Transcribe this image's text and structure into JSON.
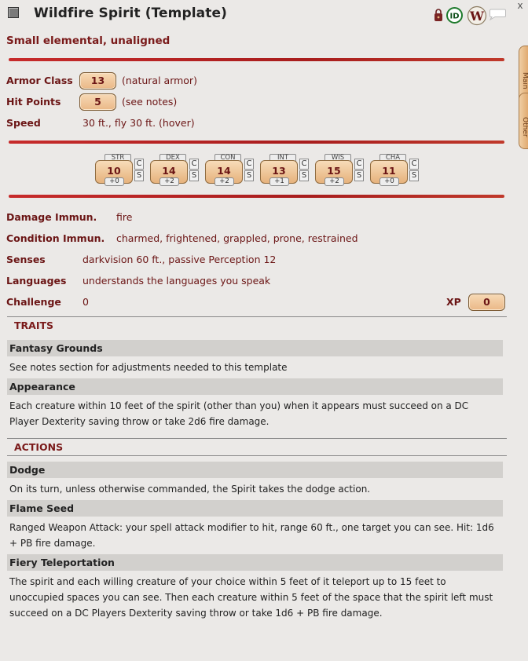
{
  "header": {
    "title": "Wildfire Spirit (Template)",
    "close": "x",
    "subtitle": "Small elemental, unaligned"
  },
  "header_icons": [
    "lock-icon",
    "id-icon",
    "wiki-icon",
    "chat-icon"
  ],
  "id_badge": "ID",
  "wiki_badge": "W",
  "side_tabs": {
    "main": "Main",
    "other": "Other"
  },
  "stats": {
    "armor_class": {
      "label": "Armor Class",
      "value": "13",
      "note": "(natural armor)"
    },
    "hit_points": {
      "label": "Hit Points",
      "value": "5",
      "note": "(see notes)"
    },
    "speed": {
      "label": "Speed",
      "value": "30 ft., fly 30 ft. (hover)"
    }
  },
  "abilities": [
    {
      "label": "STR",
      "score": "10",
      "mod": "+0"
    },
    {
      "label": "DEX",
      "score": "14",
      "mod": "+2"
    },
    {
      "label": "CON",
      "score": "14",
      "mod": "+2"
    },
    {
      "label": "INT",
      "score": "13",
      "mod": "+1"
    },
    {
      "label": "WIS",
      "score": "15",
      "mod": "+2"
    },
    {
      "label": "CHA",
      "score": "11",
      "mod": "+0"
    }
  ],
  "check_label": "C",
  "save_label": "S",
  "details": {
    "damage_immunities": {
      "label": "Damage Immun.",
      "value": "fire"
    },
    "condition_immunities": {
      "label": "Condition Immun.",
      "value": "charmed, frightened, grappled, prone, restrained"
    },
    "senses": {
      "label": "Senses",
      "value": "darkvision 60 ft., passive Perception 12"
    },
    "languages": {
      "label": "Languages",
      "value": "understands the languages you speak"
    },
    "challenge": {
      "label": "Challenge",
      "value": "0"
    },
    "xp": {
      "label": "XP",
      "value": "0"
    }
  },
  "traits": {
    "header": "TRAITS",
    "items": [
      {
        "name": "Fantasy Grounds",
        "desc": "See notes section for adjustments needed to this template"
      },
      {
        "name": "Appearance",
        "desc": "Each creature within 10 feet of the spirit (other than you) when it appears must succeed on a DC Player Dexterity saving throw or take 2d6 fire damage."
      }
    ]
  },
  "actions": {
    "header": "ACTIONS",
    "items": [
      {
        "name": "Dodge",
        "desc": "On its turn, unless otherwise commanded, the Spirit takes the dodge action."
      },
      {
        "name": "Flame Seed",
        "desc": "Ranged Weapon Attack: your spell attack modifier to hit, range 60 ft., one target you can see. Hit: 1d6 + PB fire damage."
      },
      {
        "name": "Fiery Teleportation",
        "desc": "The spirit and each willing creature of your choice within 5 feet of it teleport up to 15 feet to unoccupied spaces you can see. Then each creature within 5 feet of the space that the spirit left must succeed on a DC Players Dexterity saving throw or take 1d6 + PB fire damage."
      }
    ]
  },
  "colors": {
    "accent": "#7a1a1a",
    "divider": "#c72b2b",
    "field": "#eab887",
    "bg": "#ebe9e7",
    "item_bar": "#d2d0cd"
  }
}
